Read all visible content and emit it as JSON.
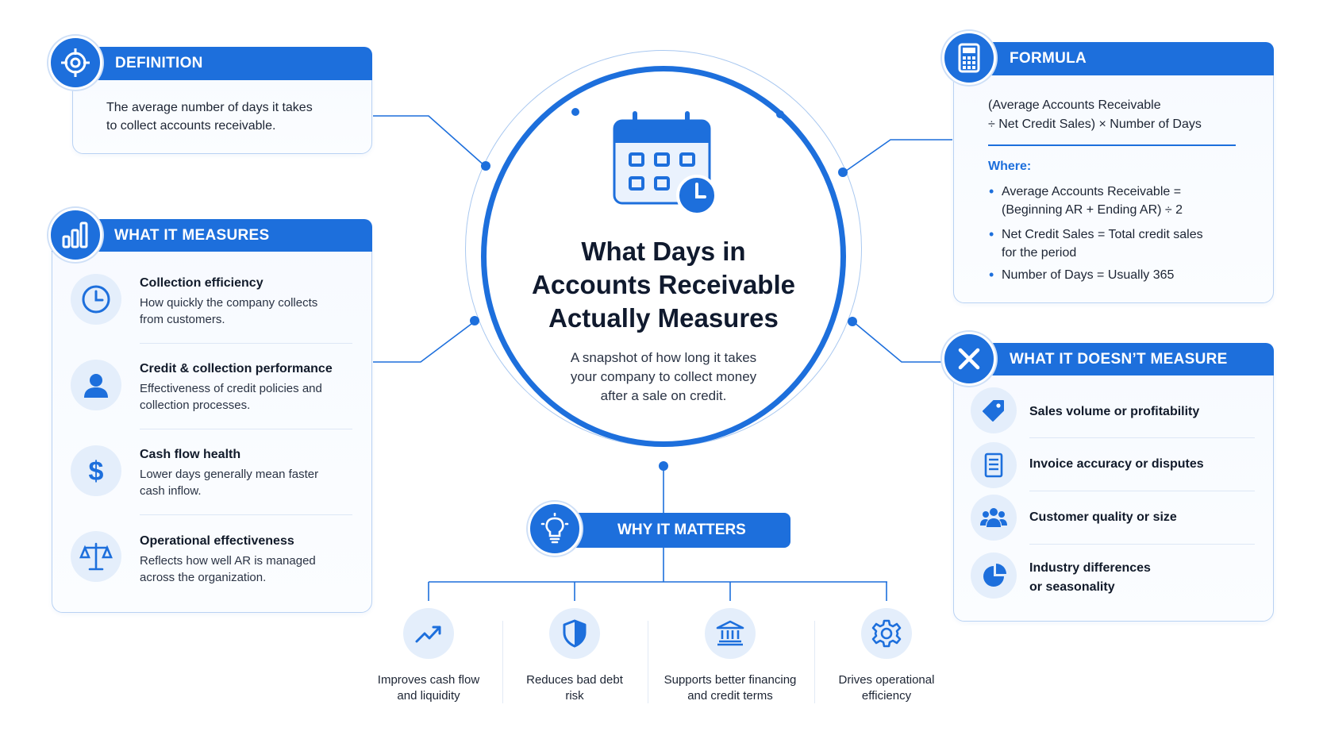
{
  "center": {
    "title_line1": "What Days in",
    "title_line2": "Accounts Receivable",
    "title_line3": "Actually Measures",
    "sub_line1": "A snapshot of how long it takes",
    "sub_line2": "your company to collect money",
    "sub_line3": "after a sale on credit."
  },
  "definition": {
    "header": "DEFINITION",
    "line1": "The average number of days it takes",
    "line2": "to collect accounts receivable."
  },
  "measures": {
    "header": "WHAT IT MEASURES",
    "items": [
      {
        "title": "Collection efficiency",
        "desc1": "How quickly the company collects",
        "desc2": "from customers.",
        "icon": "clock-icon"
      },
      {
        "title": "Credit & collection performance",
        "desc1": "Effectiveness of credit policies and",
        "desc2": "collection processes.",
        "icon": "person-icon"
      },
      {
        "title": "Cash flow health",
        "desc1": "Lower days generally mean faster",
        "desc2": "cash inflow.",
        "icon": "dollar-icon"
      },
      {
        "title": "Operational effectiveness",
        "desc1": "Reflects how well AR is managed",
        "desc2": "across the organization.",
        "icon": "scale-icon"
      }
    ]
  },
  "formula": {
    "header": "FORMULA",
    "line1": "(Average Accounts Receivable",
    "line2": "÷ Net Credit Sales) × Number of Days",
    "where": "Where:",
    "b1_line1": "Average Accounts Receivable =",
    "b1_line2": "(Beginning AR + Ending AR) ÷ 2",
    "b2_line1": "Net Credit Sales = Total credit sales",
    "b2_line2": "for the period",
    "b3_line1": "Number of Days = Usually 365"
  },
  "doesnt": {
    "header": "WHAT IT DOESN’T MEASURE",
    "items": [
      {
        "line1": "Sales volume or profitability",
        "line2": "",
        "icon": "tag-icon"
      },
      {
        "line1": "Invoice accuracy or disputes",
        "line2": "",
        "icon": "document-icon"
      },
      {
        "line1": "Customer quality or size",
        "line2": "",
        "icon": "people-icon"
      },
      {
        "line1": "Industry differences",
        "line2": "or seasonality",
        "icon": "pie-icon"
      }
    ]
  },
  "why": {
    "header": "WHY IT MATTERS",
    "items": [
      {
        "line1": "Improves cash flow",
        "line2": "and liquidity",
        "icon": "trend-up-icon"
      },
      {
        "line1": "Reduces bad debt",
        "line2": "risk",
        "icon": "shield-icon"
      },
      {
        "line1": "Supports better financing",
        "line2": "and credit terms",
        "icon": "bank-icon"
      },
      {
        "line1": "Drives operational",
        "line2": "efficiency",
        "icon": "gear-icon"
      }
    ]
  },
  "colors": {
    "accent": "#1d6fdc",
    "icon_bg": "#e4eefb",
    "card_border": "#b9d2f3"
  }
}
